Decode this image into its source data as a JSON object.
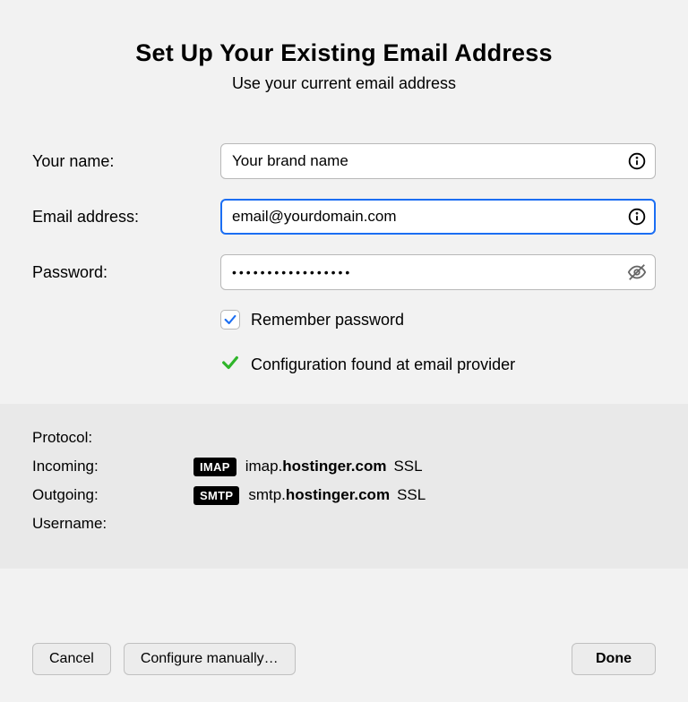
{
  "header": {
    "title": "Set Up Your Existing Email Address",
    "subtitle": "Use your current email address"
  },
  "form": {
    "name_label": "Your name:",
    "name_value": "Your brand name",
    "email_label": "Email address:",
    "email_value": "email@yourdomain.com",
    "password_label": "Password:",
    "password_mask": "•••••••••••••••••",
    "remember_label": "Remember password"
  },
  "status": {
    "message": "Configuration found at email provider"
  },
  "config": {
    "protocol_label": "Protocol:",
    "incoming_label": "Incoming:",
    "outgoing_label": "Outgoing:",
    "username_label": "Username:",
    "incoming_badge": "IMAP",
    "incoming_prefix": "imap.",
    "incoming_domain": "hostinger.com",
    "incoming_ssl": "SSL",
    "outgoing_badge": "SMTP",
    "outgoing_prefix": "smtp.",
    "outgoing_domain": "hostinger.com",
    "outgoing_ssl": "SSL"
  },
  "footer": {
    "cancel": "Cancel",
    "configure": "Configure manually…",
    "done": "Done"
  }
}
